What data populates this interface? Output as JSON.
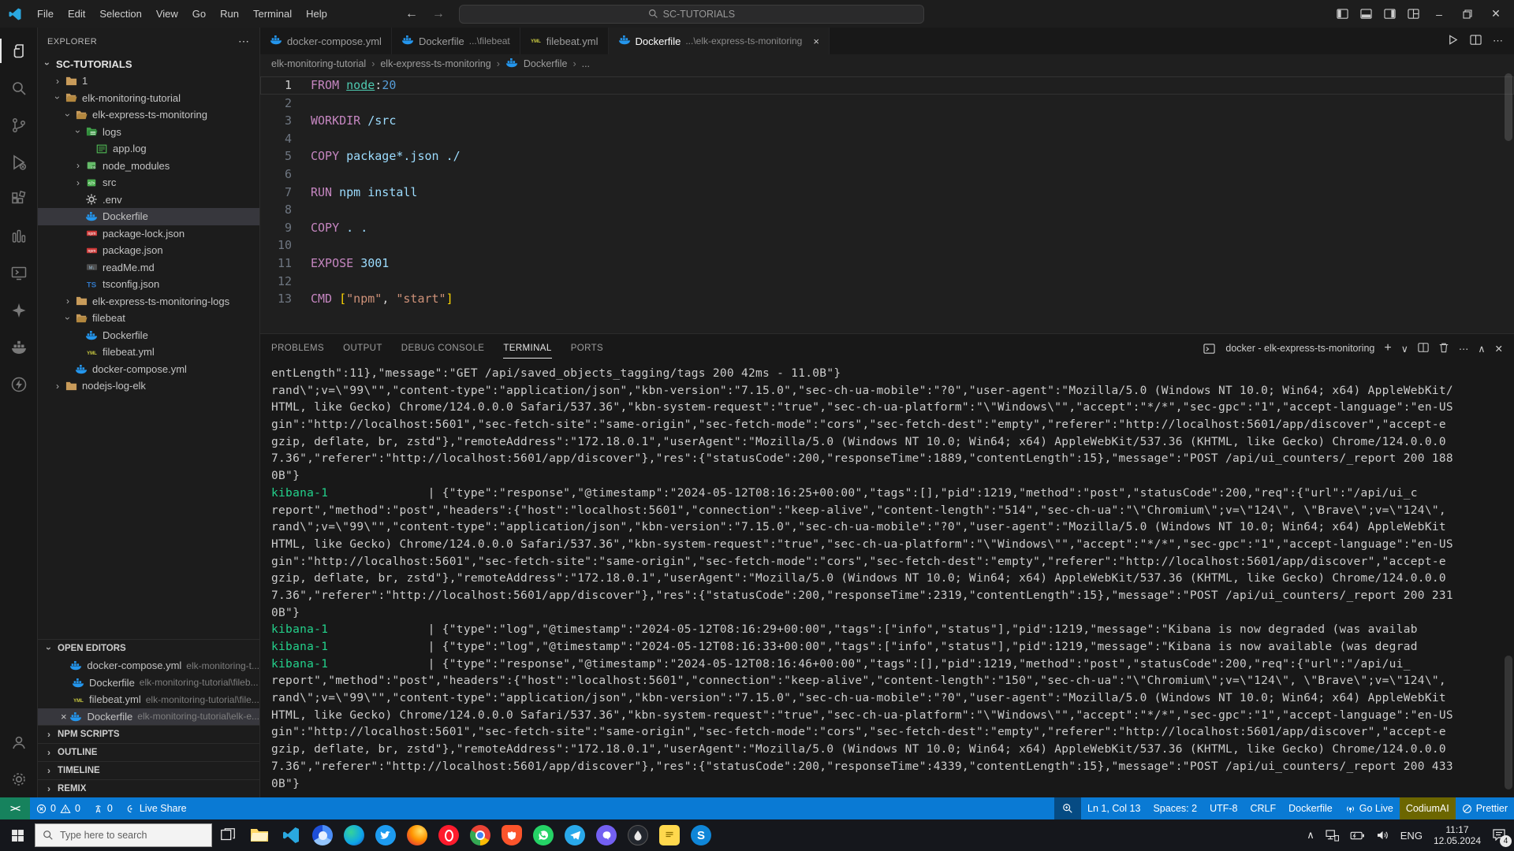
{
  "colors": {
    "status_blue": "#0a7ad4",
    "remote_green": "#16825d",
    "codium_bg": "#6c6600",
    "terminal_green": "#23d18b",
    "docker_blue": "#2496ed"
  },
  "titlebar": {
    "menus": [
      "File",
      "Edit",
      "Selection",
      "View",
      "Go",
      "Run",
      "Terminal",
      "Help"
    ],
    "search": "SC-TUTORIALS"
  },
  "activitybar": {
    "top": [
      {
        "icon": "explorer-icon",
        "active": true
      },
      {
        "icon": "search-icon",
        "active": false
      },
      {
        "icon": "source-control-icon",
        "active": false
      },
      {
        "icon": "run-debug-icon",
        "active": false
      },
      {
        "icon": "extensions-icon",
        "active": false
      },
      {
        "icon": "columns-icon",
        "active": false
      },
      {
        "icon": "remote-explorer-icon",
        "active": false
      },
      {
        "icon": "sparkle-icon",
        "active": false
      },
      {
        "icon": "docker-icon",
        "active": false
      },
      {
        "icon": "thunder-client-icon",
        "active": false
      }
    ],
    "bottom": [
      {
        "icon": "account-icon",
        "active": false
      },
      {
        "icon": "settings-gear-icon",
        "active": false
      }
    ]
  },
  "sidebar": {
    "header": "EXPLORER",
    "root": "SC-TUTORIALS",
    "tree": [
      {
        "indent": 1,
        "chevron": "right",
        "icon": "folder",
        "label": "1"
      },
      {
        "indent": 1,
        "chevron": "down",
        "icon": "folderOpen",
        "label": "elk-monitoring-tutorial"
      },
      {
        "indent": 2,
        "chevron": "down",
        "icon": "folderOpen",
        "label": "elk-express-ts-monitoring"
      },
      {
        "indent": 3,
        "chevron": "down",
        "icon": "folderGreenOpen",
        "label": "logs"
      },
      {
        "indent": 4,
        "chevron": null,
        "icon": "logfile",
        "label": "app.log"
      },
      {
        "indent": 3,
        "chevron": "right",
        "icon": "box",
        "label": "node_modules"
      },
      {
        "indent": 3,
        "chevron": "right",
        "icon": "code",
        "label": "src"
      },
      {
        "indent": 3,
        "chevron": null,
        "icon": "gear",
        "label": ".env"
      },
      {
        "indent": 3,
        "chevron": null,
        "icon": "docker",
        "label": "Dockerfile",
        "selected": true
      },
      {
        "indent": 3,
        "chevron": null,
        "icon": "npm",
        "label": "package-lock.json"
      },
      {
        "indent": 3,
        "chevron": null,
        "icon": "npm",
        "label": "package.json"
      },
      {
        "indent": 3,
        "chevron": null,
        "icon": "md",
        "label": "readMe.md"
      },
      {
        "indent": 3,
        "chevron": null,
        "icon": "ts",
        "label": "tsconfig.json"
      },
      {
        "indent": 2,
        "chevron": "right",
        "icon": "folder",
        "label": "elk-express-ts-monitoring-logs"
      },
      {
        "indent": 2,
        "chevron": "down",
        "icon": "folderOpen",
        "label": "filebeat"
      },
      {
        "indent": 3,
        "chevron": null,
        "icon": "docker",
        "label": "Dockerfile"
      },
      {
        "indent": 3,
        "chevron": null,
        "icon": "yml",
        "label": "filebeat.yml"
      },
      {
        "indent": 2,
        "chevron": null,
        "icon": "docker",
        "label": "docker-compose.yml"
      },
      {
        "indent": 1,
        "chevron": "right",
        "icon": "folder",
        "label": "nodejs-log-elk"
      }
    ],
    "open_editors_label": "OPEN EDITORS",
    "open_editors": [
      {
        "icon": "docker",
        "label": "docker-compose.yml",
        "desc": "elk-monitoring-t...",
        "active": false
      },
      {
        "icon": "docker",
        "label": "Dockerfile",
        "desc": "elk-monitoring-tutorial\\fileb...",
        "active": false
      },
      {
        "icon": "yml",
        "label": "filebeat.yml",
        "desc": "elk-monitoring-tutorial\\file...",
        "active": false
      },
      {
        "icon": "docker",
        "label": "Dockerfile",
        "desc": "elk-monitoring-tutorial\\elk-e...",
        "active": true
      }
    ],
    "sections": [
      "NPM SCRIPTS",
      "OUTLINE",
      "TIMELINE",
      "REMIX"
    ]
  },
  "tabs": [
    {
      "icon": "docker",
      "label": "docker-compose.yml",
      "dim": "",
      "active": false
    },
    {
      "icon": "docker",
      "label": "Dockerfile",
      "dim": "...\\filebeat",
      "active": false
    },
    {
      "icon": "yml",
      "label": "filebeat.yml",
      "dim": "",
      "active": false
    },
    {
      "icon": "docker",
      "label": "Dockerfile",
      "dim": "...\\elk-express-ts-monitoring",
      "active": true
    }
  ],
  "breadcrumb": {
    "items": [
      "elk-monitoring-tutorial",
      "elk-express-ts-monitoring",
      "Dockerfile",
      "..."
    ]
  },
  "editor": {
    "lines": [
      {
        "n": "1",
        "current": true,
        "segs": [
          {
            "c": "tok-k",
            "t": "FROM "
          },
          {
            "c": "tok-link",
            "t": "node"
          },
          {
            "c": "tok-fg",
            "t": ":"
          },
          {
            "c": "tok-num",
            "t": "20"
          }
        ]
      },
      {
        "n": "2",
        "segs": []
      },
      {
        "n": "3",
        "segs": [
          {
            "c": "tok-k",
            "t": "WORKDIR "
          },
          {
            "c": "tok-arg",
            "t": "/src"
          }
        ]
      },
      {
        "n": "4",
        "segs": []
      },
      {
        "n": "5",
        "segs": [
          {
            "c": "tok-k",
            "t": "COPY "
          },
          {
            "c": "tok-arg",
            "t": "package*.json ./"
          }
        ]
      },
      {
        "n": "6",
        "segs": []
      },
      {
        "n": "7",
        "segs": [
          {
            "c": "tok-k",
            "t": "RUN "
          },
          {
            "c": "tok-arg",
            "t": "npm install"
          }
        ]
      },
      {
        "n": "8",
        "segs": []
      },
      {
        "n": "9",
        "segs": [
          {
            "c": "tok-k",
            "t": "COPY "
          },
          {
            "c": "tok-arg",
            "t": ". ."
          }
        ]
      },
      {
        "n": "10",
        "segs": []
      },
      {
        "n": "11",
        "segs": [
          {
            "c": "tok-k",
            "t": "EXPOSE "
          },
          {
            "c": "tok-arg",
            "t": "3001"
          }
        ]
      },
      {
        "n": "12",
        "segs": []
      },
      {
        "n": "13",
        "segs": [
          {
            "c": "tok-k",
            "t": "CMD "
          },
          {
            "c": "tok-br",
            "t": "["
          },
          {
            "c": "tok-str",
            "t": "\"npm\""
          },
          {
            "c": "tok-fg",
            "t": ", "
          },
          {
            "c": "tok-str",
            "t": "\"start\""
          },
          {
            "c": "tok-br",
            "t": "]"
          }
        ]
      }
    ]
  },
  "panel": {
    "tabs": [
      "PROBLEMS",
      "OUTPUT",
      "DEBUG CONSOLE",
      "TERMINAL",
      "PORTS"
    ],
    "active_tab": "TERMINAL",
    "terminal_title": "docker - elk-express-ts-monitoring"
  },
  "terminal": {
    "lines": [
      [
        {
          "c": "",
          "t": "entLength\":11},\"message\":\"GET /api/saved_objects_tagging/tags 200 42ms - 11.0B\"}"
        }
      ],
      [
        {
          "c": "",
          "t": "rand\\\";v=\\\"99\\\"\",\"content-type\":\"application/json\",\"kbn-version\":\"7.15.0\",\"sec-ch-ua-mobile\":\"?0\",\"user-agent\":\"Mozilla/5.0 (Windows NT 10.0; Win64; x64) AppleWebKit/"
        }
      ],
      [
        {
          "c": "",
          "t": "HTML, like Gecko) Chrome/124.0.0.0 Safari/537.36\",\"kbn-system-request\":\"true\",\"sec-ch-ua-platform\":\"\\\"Windows\\\"\",\"accept\":\"*/*\",\"sec-gpc\":\"1\",\"accept-language\":\"en-US"
        }
      ],
      [
        {
          "c": "",
          "t": "gin\":\"http://localhost:5601\",\"sec-fetch-site\":\"same-origin\",\"sec-fetch-mode\":\"cors\",\"sec-fetch-dest\":\"empty\",\"referer\":\"http://localhost:5601/app/discover\",\"accept-e"
        }
      ],
      [
        {
          "c": "",
          "t": "gzip, deflate, br, zstd\"},\"remoteAddress\":\"172.18.0.1\",\"userAgent\":\"Mozilla/5.0 (Windows NT 10.0; Win64; x64) AppleWebKit/537.36 (KHTML, like Gecko) Chrome/124.0.0.0"
        }
      ],
      [
        {
          "c": "",
          "t": "7.36\",\"referer\":\"http://localhost:5601/app/discover\"},\"res\":{\"statusCode\":200,\"responseTime\":1889,\"contentLength\":15},\"message\":\"POST /api/ui_counters/_report 200 188"
        }
      ],
      [
        {
          "c": "",
          "t": "0B\"}"
        }
      ],
      [
        {
          "c": "tgreen",
          "t": "kibana-1"
        },
        {
          "c": "",
          "t": "              | {\"type\":\"response\",\"@timestamp\":\"2024-05-12T08:16:25+00:00\",\"tags\":[],\"pid\":1219,\"method\":\"post\",\"statusCode\":200,\"req\":{\"url\":\"/api/ui_c"
        }
      ],
      [
        {
          "c": "",
          "t": "report\",\"method\":\"post\",\"headers\":{\"host\":\"localhost:5601\",\"connection\":\"keep-alive\",\"content-length\":\"514\",\"sec-ch-ua\":\"\\\"Chromium\\\";v=\\\"124\\\", \\\"Brave\\\";v=\\\"124\\\","
        }
      ],
      [
        {
          "c": "",
          "t": "rand\\\";v=\\\"99\\\"\",\"content-type\":\"application/json\",\"kbn-version\":\"7.15.0\",\"sec-ch-ua-mobile\":\"?0\",\"user-agent\":\"Mozilla/5.0 (Windows NT 10.0; Win64; x64) AppleWebKit"
        }
      ],
      [
        {
          "c": "",
          "t": "HTML, like Gecko) Chrome/124.0.0.0 Safari/537.36\",\"kbn-system-request\":\"true\",\"sec-ch-ua-platform\":\"\\\"Windows\\\"\",\"accept\":\"*/*\",\"sec-gpc\":\"1\",\"accept-language\":\"en-US"
        }
      ],
      [
        {
          "c": "",
          "t": "gin\":\"http://localhost:5601\",\"sec-fetch-site\":\"same-origin\",\"sec-fetch-mode\":\"cors\",\"sec-fetch-dest\":\"empty\",\"referer\":\"http://localhost:5601/app/discover\",\"accept-e"
        }
      ],
      [
        {
          "c": "",
          "t": "gzip, deflate, br, zstd\"},\"remoteAddress\":\"172.18.0.1\",\"userAgent\":\"Mozilla/5.0 (Windows NT 10.0; Win64; x64) AppleWebKit/537.36 (KHTML, like Gecko) Chrome/124.0.0.0"
        }
      ],
      [
        {
          "c": "",
          "t": "7.36\",\"referer\":\"http://localhost:5601/app/discover\"},\"res\":{\"statusCode\":200,\"responseTime\":2319,\"contentLength\":15},\"message\":\"POST /api/ui_counters/_report 200 231"
        }
      ],
      [
        {
          "c": "",
          "t": "0B\"}"
        }
      ],
      [
        {
          "c": "tgreen",
          "t": "kibana-1"
        },
        {
          "c": "",
          "t": "              | {\"type\":\"log\",\"@timestamp\":\"2024-05-12T08:16:29+00:00\",\"tags\":[\"info\",\"status\"],\"pid\":1219,\"message\":\"Kibana is now degraded (was availab"
        }
      ],
      [
        {
          "c": "tgreen",
          "t": "kibana-1"
        },
        {
          "c": "",
          "t": "              | {\"type\":\"log\",\"@timestamp\":\"2024-05-12T08:16:33+00:00\",\"tags\":[\"info\",\"status\"],\"pid\":1219,\"message\":\"Kibana is now available (was degrad"
        }
      ],
      [
        {
          "c": "tgreen",
          "t": "kibana-1"
        },
        {
          "c": "",
          "t": "              | {\"type\":\"response\",\"@timestamp\":\"2024-05-12T08:16:46+00:00\",\"tags\":[],\"pid\":1219,\"method\":\"post\",\"statusCode\":200,\"req\":{\"url\":\"/api/ui_"
        }
      ],
      [
        {
          "c": "",
          "t": "report\",\"method\":\"post\",\"headers\":{\"host\":\"localhost:5601\",\"connection\":\"keep-alive\",\"content-length\":\"150\",\"sec-ch-ua\":\"\\\"Chromium\\\";v=\\\"124\\\", \\\"Brave\\\";v=\\\"124\\\","
        }
      ],
      [
        {
          "c": "",
          "t": "rand\\\";v=\\\"99\\\"\",\"content-type\":\"application/json\",\"kbn-version\":\"7.15.0\",\"sec-ch-ua-mobile\":\"?0\",\"user-agent\":\"Mozilla/5.0 (Windows NT 10.0; Win64; x64) AppleWebKit"
        }
      ],
      [
        {
          "c": "",
          "t": "HTML, like Gecko) Chrome/124.0.0.0 Safari/537.36\",\"kbn-system-request\":\"true\",\"sec-ch-ua-platform\":\"\\\"Windows\\\"\",\"accept\":\"*/*\",\"sec-gpc\":\"1\",\"accept-language\":\"en-US"
        }
      ],
      [
        {
          "c": "",
          "t": "gin\":\"http://localhost:5601\",\"sec-fetch-site\":\"same-origin\",\"sec-fetch-mode\":\"cors\",\"sec-fetch-dest\":\"empty\",\"referer\":\"http://localhost:5601/app/discover\",\"accept-e"
        }
      ],
      [
        {
          "c": "",
          "t": "gzip, deflate, br, zstd\"},\"remoteAddress\":\"172.18.0.1\",\"userAgent\":\"Mozilla/5.0 (Windows NT 10.0; Win64; x64) AppleWebKit/537.36 (KHTML, like Gecko) Chrome/124.0.0.0"
        }
      ],
      [
        {
          "c": "",
          "t": "7.36\",\"referer\":\"http://localhost:5601/app/discover\"},\"res\":{\"statusCode\":200,\"responseTime\":4339,\"contentLength\":15},\"message\":\"POST /api/ui_counters/_report 200 433"
        }
      ],
      [
        {
          "c": "",
          "t": "0B\"}"
        }
      ]
    ]
  },
  "statusbar": {
    "remote": "><",
    "errors": "0",
    "warnings": "0",
    "ports": "0",
    "live_share": "Live Share",
    "line_col": "Ln 1, Col 13",
    "spaces": "Spaces: 2",
    "encoding": "UTF-8",
    "eol": "CRLF",
    "language": "Dockerfile",
    "go_live": "Go Live",
    "codium": "CodiumAI",
    "prettier": "Prettier"
  },
  "taskbar": {
    "search_placeholder": "Type here to search",
    "apps": [
      "task-view-icon",
      "file-explorer-icon",
      "vscode-icon",
      "chromium-icon",
      "edge-icon",
      "twitter-icon",
      "firefox-icon",
      "opera-icon",
      "chrome-icon",
      "brave-icon",
      "whatsapp-icon",
      "telegram-icon",
      "viber-icon",
      "drop-icon",
      "notes-icon",
      "skype-icon"
    ],
    "tray_lang": "ENG",
    "time": "11:17",
    "date": "12.05.2024",
    "notification_badge": "4"
  }
}
